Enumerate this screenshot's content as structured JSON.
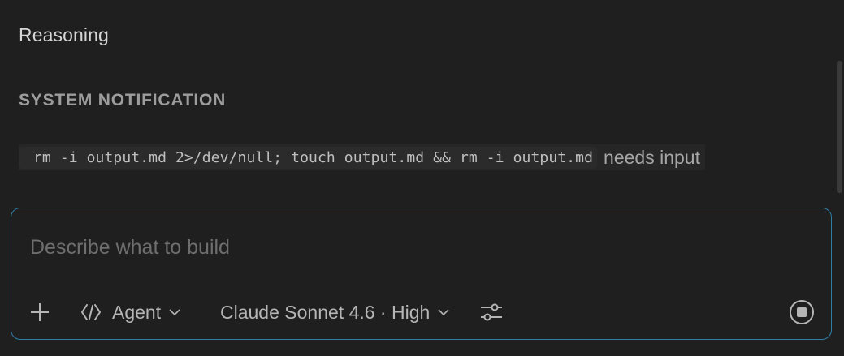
{
  "reasoning": {
    "label": "Reasoning"
  },
  "notification": {
    "title": "SYSTEM NOTIFICATION",
    "command": "rm -i output.md 2>/dev/null; touch output.md && rm -i output.md",
    "status": "needs input"
  },
  "composer": {
    "placeholder": "Describe what to build",
    "mode_label": "Agent",
    "model_label": "Claude Sonnet 4.6 · High"
  },
  "icons": {
    "add": "plus-icon",
    "mode": "code-brackets-icon",
    "chevron": "chevron-down-icon",
    "settings": "sliders-icon",
    "stop": "stop-icon"
  },
  "colors": {
    "background": "#1f1f1f",
    "input_border": "#2d7fa8",
    "muted_text": "#6e6e6e"
  }
}
